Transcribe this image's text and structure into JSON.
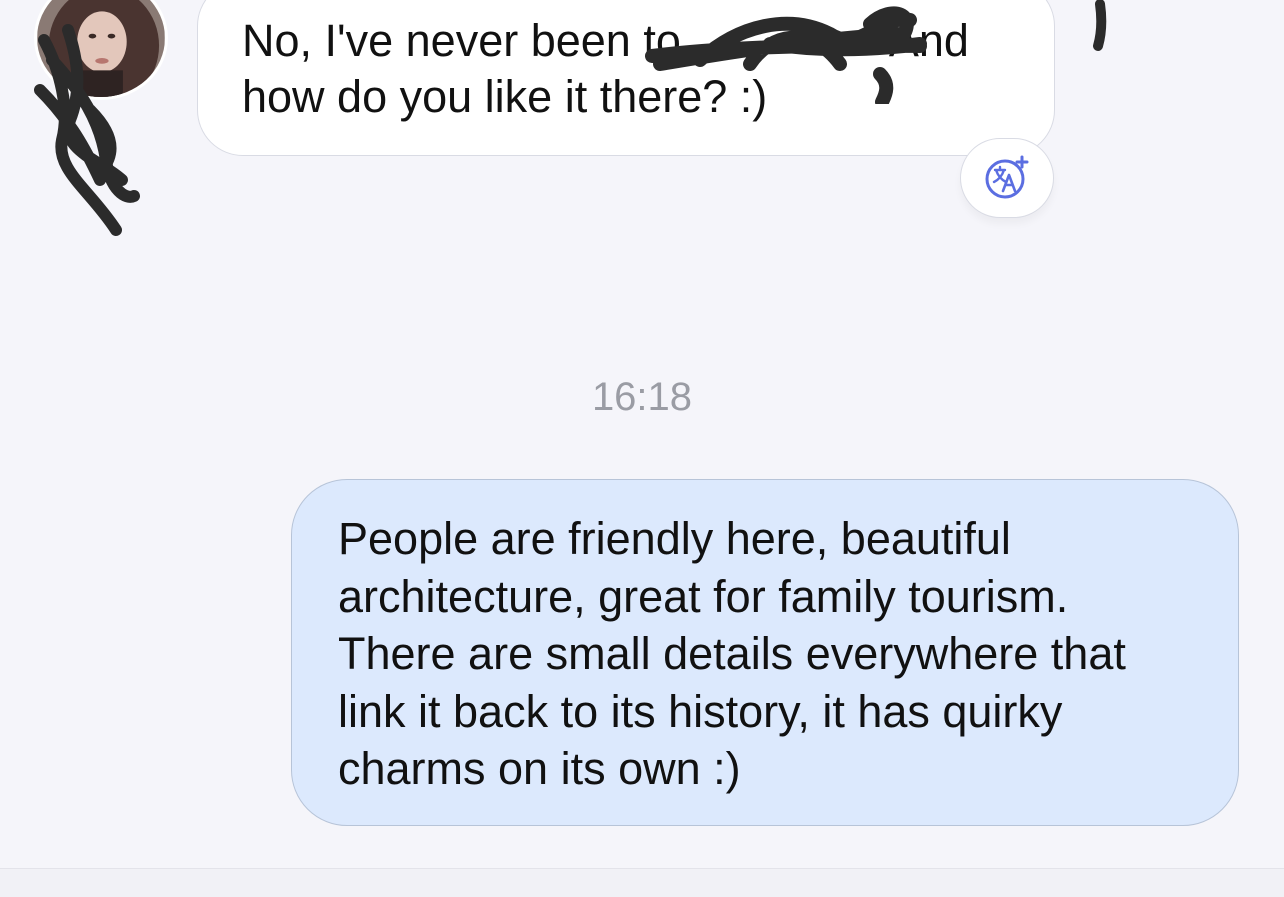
{
  "incoming_message": {
    "text": "No, I've never been to [redacted]. And how do you like it there? :)",
    "line1_before": "No, I've never been to",
    "line1_after": "And",
    "line2": "how do you like it there? :)"
  },
  "translate_button": {
    "icon": "translate-icon"
  },
  "timestamp": "16:18",
  "outgoing_message": {
    "lines": [
      "People are friendly here, beautiful",
      "architecture, great for family tourism.",
      "There are small details everywhere that",
      "link it back to its history, it has quirky",
      "charms on its own :)"
    ]
  },
  "colors": {
    "background": "#f5f5fa",
    "incoming_bubble": "#ffffff",
    "outgoing_bubble": "#dce9fd",
    "accent": "#5b6ee1",
    "timestamp": "#9a9ca4",
    "text": "#111111"
  }
}
